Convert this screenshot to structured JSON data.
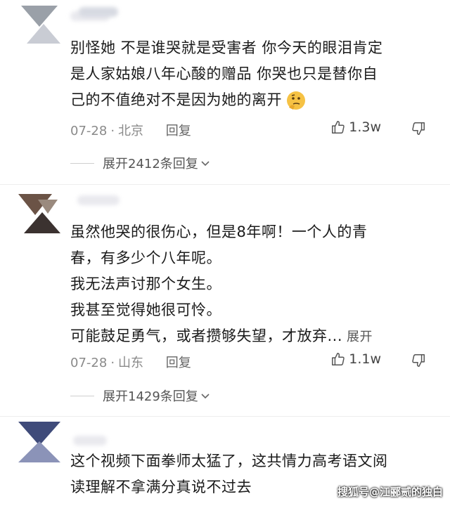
{
  "comments": [
    {
      "lines": [
        "别怪她 不是谁哭就是受害者 你今天的眼泪肯定",
        "是人家姑娘八年心酸的赠品 你哭也只是替你自",
        "己的不值绝对不是因为她的离开"
      ],
      "date": "07-28",
      "dot": "·",
      "location": "北京",
      "reply_label": "回复",
      "likes": "1.3w",
      "expand_replies": "展开2412条回复",
      "avatar_colors": [
        "#9aa0a8",
        "#c9ccd4",
        "#7f8ea3",
        "#b7bcc6"
      ]
    },
    {
      "lines": [
        "虽然他哭的很伤心，但是8年啊！一个人的青",
        "春，有多少个八年呢。",
        "我无法声讨那个女生。",
        "我甚至觉得她很可怜。",
        "可能鼓足勇气，或者攒够失望，才放弃..."
      ],
      "inline_expand": "展开",
      "date": "07-28",
      "dot": "·",
      "location": "山东",
      "reply_label": "回复",
      "likes": "1.1w",
      "expand_replies": "展开1429条回复",
      "avatar_colors": [
        "#6b5346",
        "#3b3230",
        "#9a8a7e",
        "#2f2b2a"
      ]
    },
    {
      "lines": [
        "这个视频下面拳师太猛了，这共情力高考语文阅",
        "读理解不拿满分真说不过去"
      ],
      "avatar_colors": [
        "#3f4b7a",
        "#8b93b8",
        "#2d3560",
        "#a6aed0"
      ]
    }
  ],
  "watermark": "搜狐号@江郦贰的独白",
  "icons": {
    "like": "thumbs-up-icon",
    "dislike": "thumbs-down-icon",
    "chevron": "chevron-down-icon",
    "emoji": "thinking-face-emoji"
  }
}
